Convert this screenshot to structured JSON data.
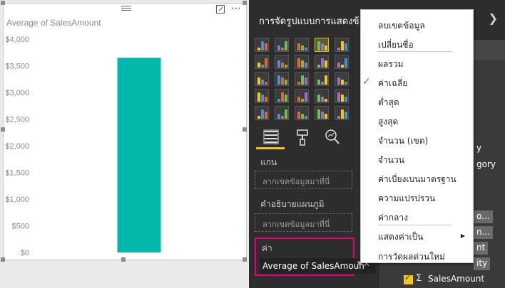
{
  "visual": {
    "title": "Average of SalesAmount"
  },
  "chart_data": {
    "type": "bar",
    "title": "Average of SalesAmount",
    "categories": [
      ""
    ],
    "series": [
      {
        "values": [
          3650
        ]
      }
    ],
    "ylim": [
      0,
      4000
    ],
    "y_ticks": [
      "$4,000",
      "$3,500",
      "$3,000",
      "$2,500",
      "$2,000",
      "$1,500",
      "$1,000",
      "$500",
      "$0"
    ],
    "grid": false,
    "bar_color": "#01b8aa"
  },
  "viz_pane": {
    "title": "การจัดรูปแบบการแสดงข้อมู",
    "expand_icon": "chevron-right-icon",
    "tabs": [
      "fields-icon",
      "format-paint-icon",
      "analytics-icon"
    ],
    "axis_label": "แกน",
    "axis_placeholder": "ลากเขตข้อมูลมาที่นี่",
    "legend_label": "คำอธิบายแผนภูมิ",
    "legend_placeholder": "ลากเขตข้อมูลมาที่นี่",
    "value_label": "ค่า",
    "value_field": "Average of SalesAmoun"
  },
  "fields_pane": {
    "partial_texts": [
      "y",
      "gory"
    ],
    "buttons": [
      "o...",
      "n...",
      "nt",
      "ity"
    ],
    "checked_field": "SalesAmount"
  },
  "context_menu": {
    "items": [
      {
        "label": "ลบเขตข้อมูล"
      },
      {
        "label": "เปลี่ยนชื่อ"
      },
      {
        "label": "ผลรวม"
      },
      {
        "label": "ค่าเฉลี่ย",
        "checked": true
      },
      {
        "label": "ต่ำสุด"
      },
      {
        "label": "สูงสุด"
      },
      {
        "label": "จำนวน (เขต)"
      },
      {
        "label": "จำนวน"
      },
      {
        "label": "ค่าเบี่ยงเบนมาตรฐาน"
      },
      {
        "label": "ความแปรปรวน"
      },
      {
        "label": "ค่ากลาง"
      },
      {
        "label": "แสดงค่าเป็น",
        "submenu": true
      },
      {
        "label": "การวัดผลด่วนใหม่"
      }
    ]
  },
  "colors": {
    "accent": "#01b8aa",
    "highlight": "#e6007e",
    "yellow": "#f2c811"
  }
}
